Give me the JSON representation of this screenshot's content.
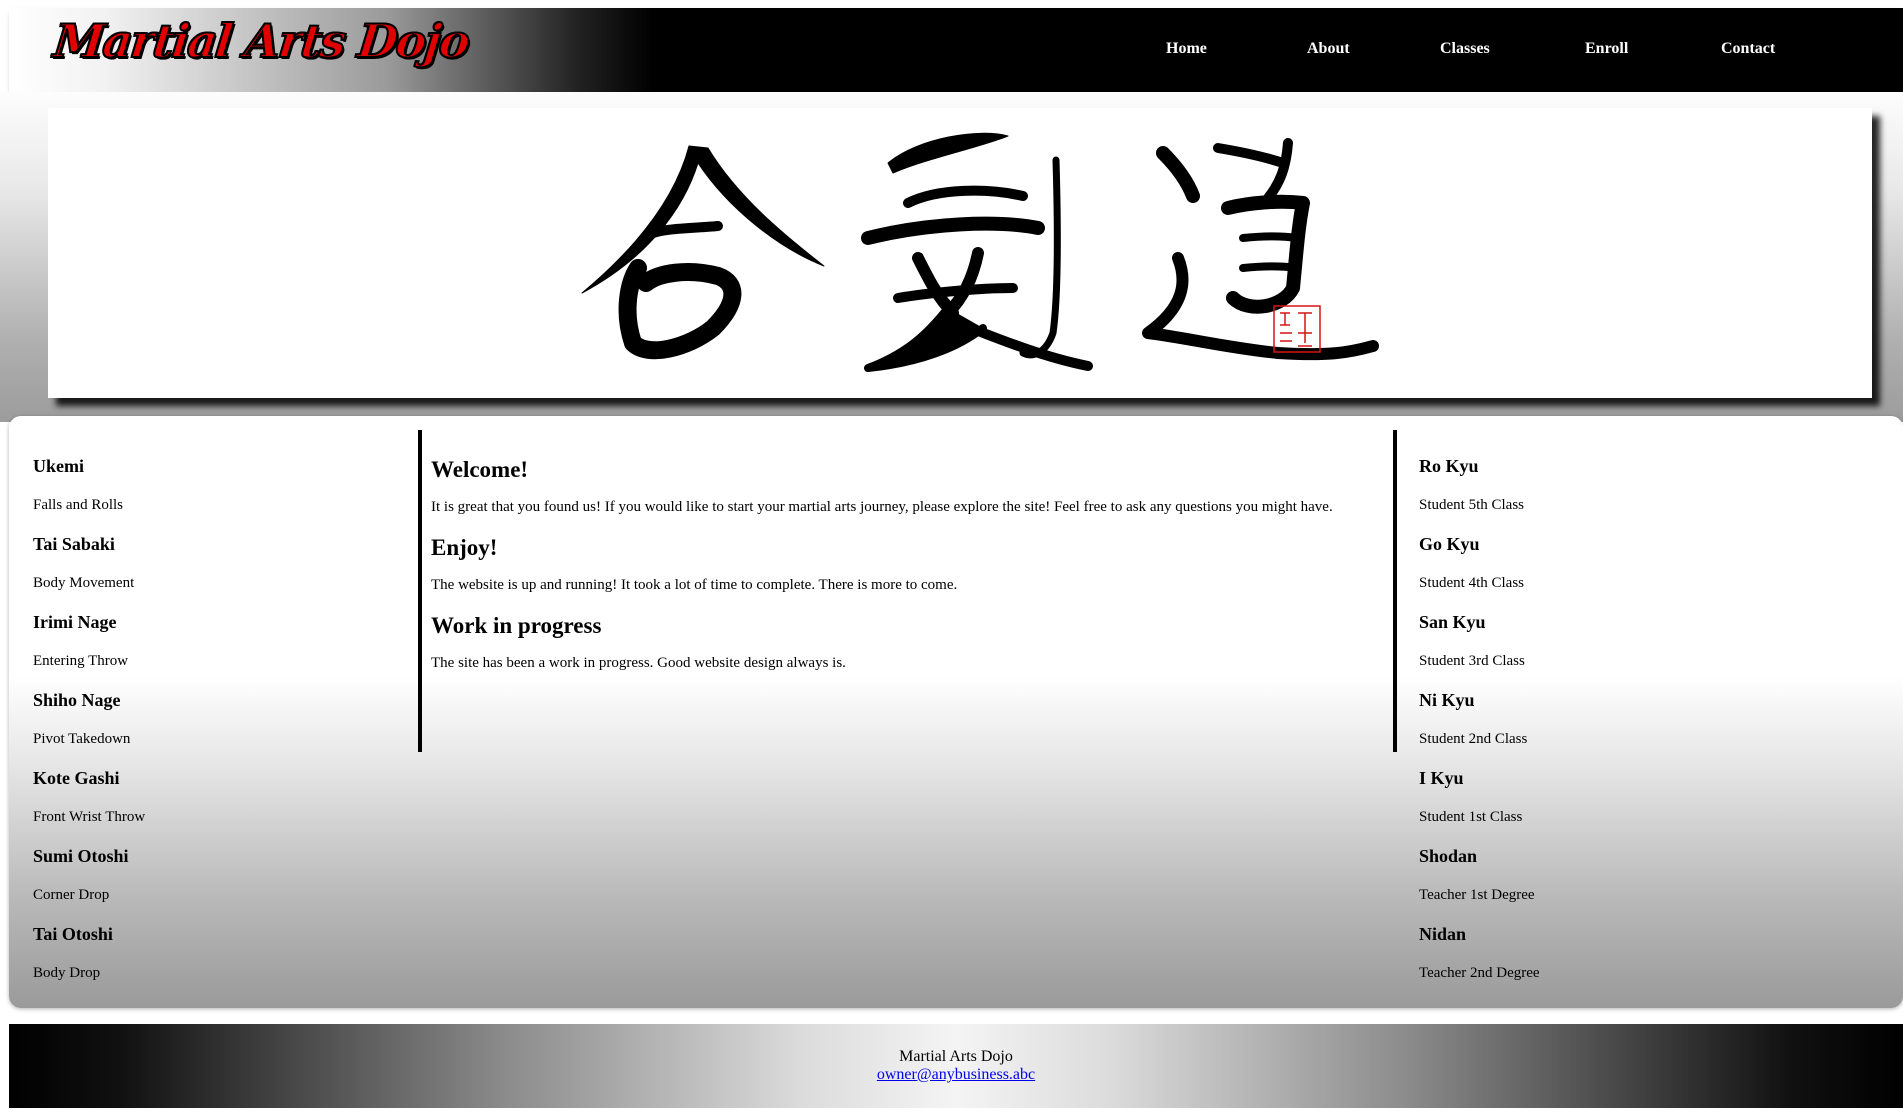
{
  "header": {
    "logo_text": "Martial Arts Dojo",
    "nav": [
      {
        "label": "Home"
      },
      {
        "label": "About"
      },
      {
        "label": "Classes"
      },
      {
        "label": "Enroll"
      },
      {
        "label": "Contact"
      }
    ]
  },
  "banner": {
    "image": "aikido-calligraphy",
    "seal": "red-seal-stamp"
  },
  "techniques": [
    {
      "name": "Ukemi",
      "desc": "Falls and Rolls"
    },
    {
      "name": "Tai Sabaki",
      "desc": "Body Movement"
    },
    {
      "name": "Irimi Nage",
      "desc": "Entering Throw"
    },
    {
      "name": "Shiho Nage",
      "desc": "Pivot Takedown"
    },
    {
      "name": "Kote Gashi",
      "desc": "Front Wrist Throw"
    },
    {
      "name": "Sumi Otoshi",
      "desc": "Corner Drop"
    },
    {
      "name": "Tai Otoshi",
      "desc": "Body Drop"
    }
  ],
  "ranks": [
    {
      "name": "Ro Kyu",
      "desc": "Student 5th Class"
    },
    {
      "name": "Go Kyu",
      "desc": "Student 4th Class"
    },
    {
      "name": "San Kyu",
      "desc": "Student 3rd Class"
    },
    {
      "name": "Ni Kyu",
      "desc": "Student 2nd Class"
    },
    {
      "name": "I Kyu",
      "desc": "Student 1st Class"
    },
    {
      "name": "Shodan",
      "desc": "Teacher 1st Degree"
    },
    {
      "name": "Nidan",
      "desc": "Teacher 2nd Degree"
    }
  ],
  "content": {
    "sections": [
      {
        "heading": "Welcome!",
        "body": "It is great that you found us! If you would like to start your martial arts journey, please explore the site! Feel free to ask any questions you might have."
      },
      {
        "heading": "Enjoy!",
        "body": "The website is up and running! It took a lot of time to complete. There is more to come."
      },
      {
        "heading": "Work in progress",
        "body": "The site has been a work in progress. Good website design always is."
      }
    ]
  },
  "footer": {
    "name": "Martial Arts Dojo",
    "email": "owner@anybusiness.abc"
  },
  "colors": {
    "logo": "#e00000",
    "header_bg": "#000000",
    "link": "#0000ee"
  }
}
